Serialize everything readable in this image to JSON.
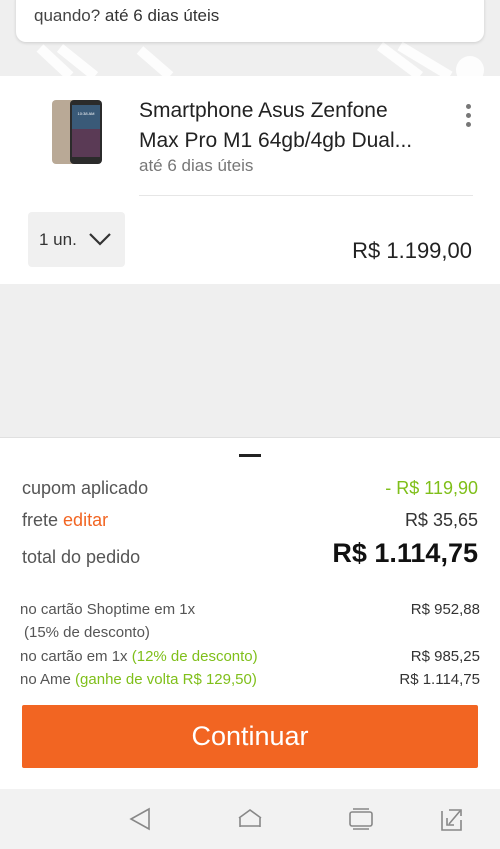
{
  "delivery": {
    "when_label": "quando?",
    "when_value": "até 6 dias úteis",
    "edit_label": "editar"
  },
  "product": {
    "title_line1": "Smartphone Asus Zenfone",
    "title_line2": "Max Pro M1 64gb/4gb Dual...",
    "shipping": "até 6 dias úteis",
    "phone_time": "10:38 AM",
    "quantity": "1 un.",
    "price": "R$ 1.199,00",
    "icons": {
      "menu": "more-vertical-icon",
      "dropdown": "chevron-down-icon"
    }
  },
  "summary": {
    "coupon_label": "cupom aplicado",
    "coupon_value": "- R$ 119,90",
    "shipping_label": "frete",
    "shipping_edit": "editar",
    "shipping_value": "R$ 35,65",
    "total_label": "total do pedido",
    "total_value": "R$ 1.114,75",
    "pay_shoptime_label": "no cartão Shoptime em 1x",
    "pay_shoptime_discount": "(15% de desconto)",
    "pay_shoptime_value": "R$ 952,88",
    "pay_card_label": "no cartão em 1x",
    "pay_card_discount": "(12% de desconto)",
    "pay_card_value": "R$ 985,25",
    "pay_ame_label": "no Ame",
    "pay_ame_cashback": "(ganhe de volta R$ 129,50)",
    "pay_ame_value": "R$ 1.114,75",
    "continue_label": "Continuar"
  },
  "colors": {
    "accent": "#f26522",
    "discount": "#7fbf1a"
  },
  "navbar": {
    "icons": [
      "back-icon",
      "home-icon",
      "recents-icon",
      "screen-expand-icon"
    ]
  }
}
